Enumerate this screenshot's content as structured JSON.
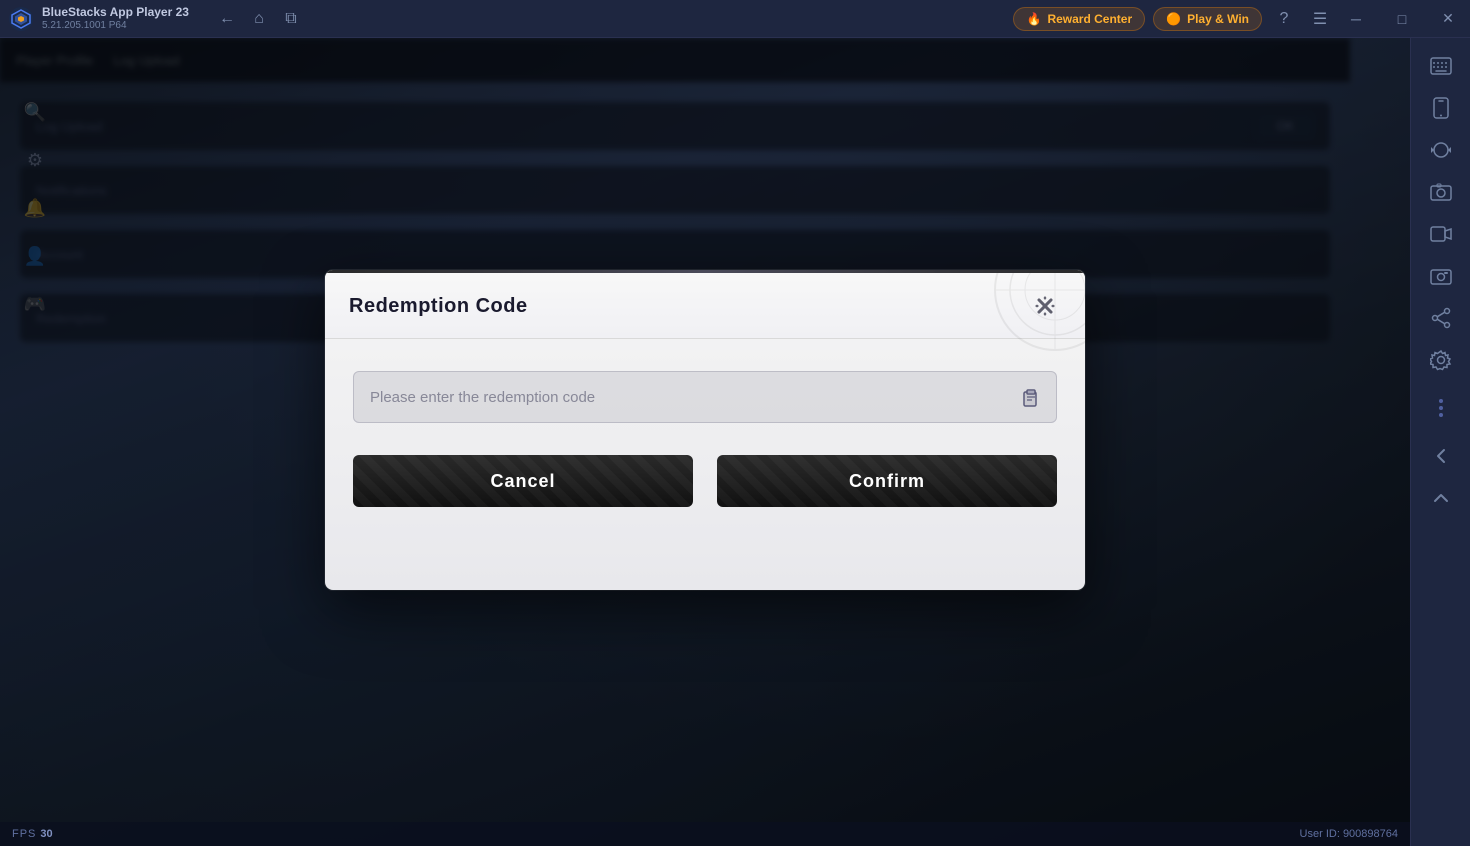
{
  "app": {
    "name": "BlueStacks App Player 23",
    "version": "5.21.205.1001 P64",
    "logo_unicode": "🎮"
  },
  "titlebar": {
    "back_label": "←",
    "home_label": "⌂",
    "duplicate_label": "⧉",
    "reward_center_label": "Reward Center",
    "play_win_label": "Play & Win",
    "help_label": "?",
    "menu_label": "☰",
    "minimize_label": "─",
    "maximize_label": "□",
    "close_label": "✕"
  },
  "sidebar": {
    "icons": [
      "⌨",
      "📱",
      "⟳",
      "⊕",
      "📸",
      "📹",
      "📷",
      "✦",
      "⚙",
      "←",
      "↑"
    ]
  },
  "bottom_bar": {
    "fps_label": "FPS",
    "fps_value": "30",
    "user_id_label": "User ID: 900898764"
  },
  "modal": {
    "title": "Redemption Code",
    "close_label": "✕",
    "input_placeholder": "Please enter the redemption code",
    "paste_icon": "📋",
    "cancel_label": "Cancel",
    "confirm_label": "Confirm"
  }
}
